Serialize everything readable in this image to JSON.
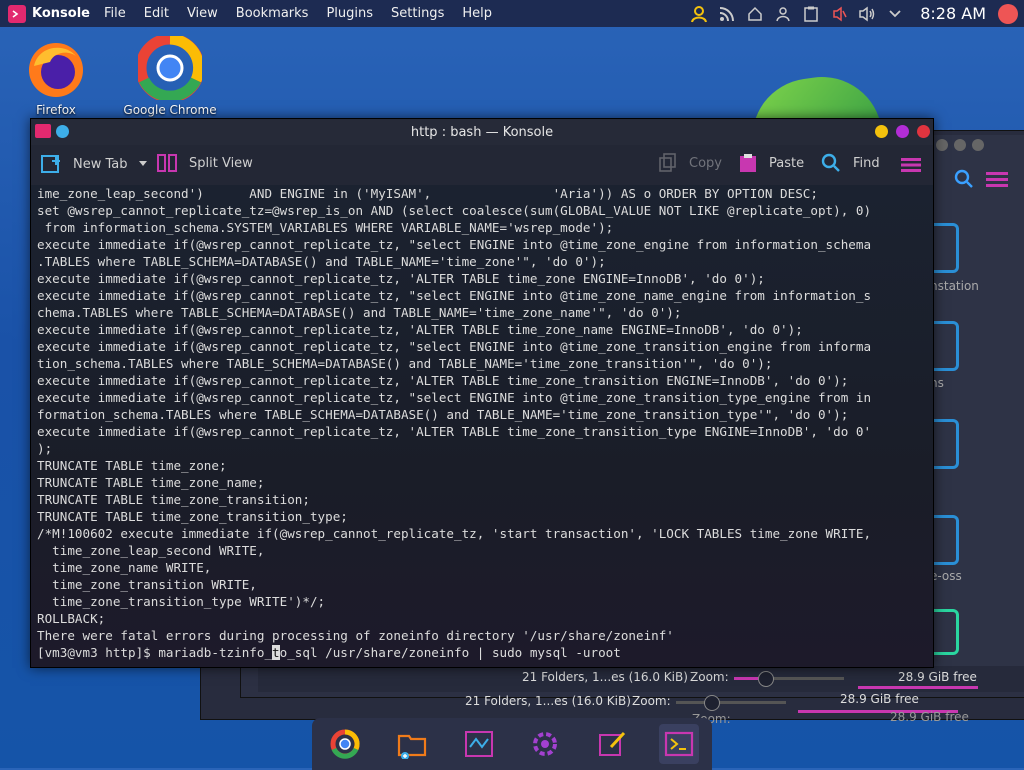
{
  "topbar": {
    "app_name": "Konsole",
    "menu": [
      "File",
      "Edit",
      "View",
      "Bookmarks",
      "Plugins",
      "Settings",
      "Help"
    ],
    "clock": "8:28 AM"
  },
  "desktop": {
    "icons": [
      {
        "label": "Firefox",
        "icon": "firefox-icon"
      },
      {
        "label": "Google Chrome",
        "icon": "chrome-icon"
      }
    ]
  },
  "konsole": {
    "title": "http : bash — Konsole",
    "toolbar": {
      "new_tab": "New Tab",
      "split_view": "Split View",
      "copy": "Copy",
      "paste": "Paste",
      "find": "Find"
    },
    "lines": [
      "ime_zone_leap_second')      AND ENGINE in ('MyISAM',                'Aria')) AS o ORDER BY OPTION DESC;",
      "set @wsrep_cannot_replicate_tz=@wsrep_is_on AND (select coalesce(sum(GLOBAL_VALUE NOT LIKE @replicate_opt), 0)",
      " from information_schema.SYSTEM_VARIABLES WHERE VARIABLE_NAME='wsrep_mode');",
      "execute immediate if(@wsrep_cannot_replicate_tz, \"select ENGINE into @time_zone_engine from information_schema",
      ".TABLES where TABLE_SCHEMA=DATABASE() and TABLE_NAME='time_zone'\", 'do 0');",
      "execute immediate if(@wsrep_cannot_replicate_tz, 'ALTER TABLE time_zone ENGINE=InnoDB', 'do 0');",
      "execute immediate if(@wsrep_cannot_replicate_tz, \"select ENGINE into @time_zone_name_engine from information_s",
      "chema.TABLES where TABLE_SCHEMA=DATABASE() and TABLE_NAME='time_zone_name'\", 'do 0');",
      "execute immediate if(@wsrep_cannot_replicate_tz, 'ALTER TABLE time_zone_name ENGINE=InnoDB', 'do 0');",
      "execute immediate if(@wsrep_cannot_replicate_tz, \"select ENGINE into @time_zone_transition_engine from informa",
      "tion_schema.TABLES where TABLE_SCHEMA=DATABASE() and TABLE_NAME='time_zone_transition'\", 'do 0');",
      "execute immediate if(@wsrep_cannot_replicate_tz, 'ALTER TABLE time_zone_transition ENGINE=InnoDB', 'do 0');",
      "execute immediate if(@wsrep_cannot_replicate_tz, \"select ENGINE into @time_zone_transition_type_engine from in",
      "formation_schema.TABLES where TABLE_SCHEMA=DATABASE() and TABLE_NAME='time_zone_transition_type'\", 'do 0');",
      "execute immediate if(@wsrep_cannot_replicate_tz, 'ALTER TABLE time_zone_transition_type ENGINE=InnoDB', 'do 0'",
      ");",
      "TRUNCATE TABLE time_zone;",
      "TRUNCATE TABLE time_zone_name;",
      "TRUNCATE TABLE time_zone_transition;",
      "TRUNCATE TABLE time_zone_transition_type;",
      "/*M!100602 execute immediate if(@wsrep_cannot_replicate_tz, 'start transaction', 'LOCK TABLES time_zone WRITE,",
      "  time_zone_leap_second WRITE,",
      "  time_zone_name WRITE,",
      "  time_zone_transition WRITE,",
      "  time_zone_transition_type WRITE')*/;",
      "ROLLBACK;",
      "There were fatal errors during processing of zoneinfo directory '/usr/share/zoneinf'"
    ],
    "prompt_before": "[vm3@vm3 http]$ mariadb-tzinfo_",
    "prompt_cursor": "t",
    "prompt_after": "o_sql /usr/share/zoneinfo | sudo mysql -uroot"
  },
  "back_windows": {
    "labels": [
      "nstation",
      "ns",
      "i",
      "e-oss"
    ],
    "status_rows": [
      {
        "text": "21 Folders, 1...es (16.0 KiB)",
        "zoom": "Zoom:",
        "free": "28.9 GiB free"
      },
      {
        "text": "21 Folders, 1...es (16.0 KiB)",
        "zoom": "Zoom:",
        "free": "28.9 GiB free"
      },
      {
        "zoom": "Zoom:",
        "free": "28.9 GiB free"
      }
    ]
  },
  "dock": {
    "items": [
      "chrome-icon",
      "file-manager-icon",
      "settings-icon",
      "discover-icon",
      "edit-icon",
      "konsole-icon"
    ]
  },
  "colors": {
    "accent": "#e2296f",
    "panel": "#1d2b52",
    "terminal_bg": "#1a1d28"
  }
}
